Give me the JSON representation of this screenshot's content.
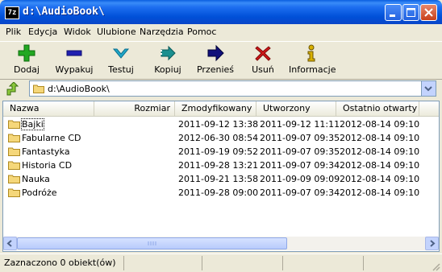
{
  "window": {
    "title": "d:\\AudioBook\\",
    "app_icon": "7z"
  },
  "menu": [
    "Plik",
    "Edycja",
    "Widok",
    "Ulubione",
    "Narzędzia",
    "Pomoc"
  ],
  "toolbar": [
    {
      "label": "Dodaj",
      "icon": "plus-icon",
      "color": "#22a822"
    },
    {
      "label": "Wypakuj",
      "icon": "minus-icon",
      "color": "#2020b0"
    },
    {
      "label": "Testuj",
      "icon": "check-icon",
      "color": "#1fa8c8"
    },
    {
      "label": "Kopiuj",
      "icon": "copy-arrow-icon",
      "color": "#1a8f8f"
    },
    {
      "label": "Przenieś",
      "icon": "move-arrow-icon",
      "color": "#10107a"
    },
    {
      "label": "Usuń",
      "icon": "delete-x-icon",
      "color": "#d01818"
    },
    {
      "label": "Informacje",
      "icon": "info-icon",
      "color": "#d8b000"
    }
  ],
  "address": {
    "path": "d:\\AudioBook\\"
  },
  "columns": [
    "Nazwa",
    "Rozmiar",
    "Zmodyfikowany",
    "Utworzony",
    "Ostatnio otwarty"
  ],
  "rows": [
    {
      "name": "Bajki",
      "size": "",
      "modified": "2011-09-12 13:38",
      "created": "2011-09-12 11:11",
      "accessed": "2012-08-14 09:10"
    },
    {
      "name": "Fabularne CD",
      "size": "",
      "modified": "2012-06-30 08:54",
      "created": "2011-09-07 09:35",
      "accessed": "2012-08-14 09:10"
    },
    {
      "name": "Fantastyka",
      "size": "",
      "modified": "2011-09-19 09:52",
      "created": "2011-09-07 09:35",
      "accessed": "2012-08-14 09:10"
    },
    {
      "name": "Historia CD",
      "size": "",
      "modified": "2011-09-28 13:21",
      "created": "2011-09-07 09:34",
      "accessed": "2012-08-14 09:10"
    },
    {
      "name": "Nauka",
      "size": "",
      "modified": "2011-09-21 13:58",
      "created": "2011-09-09 09:09",
      "accessed": "2012-08-14 09:10"
    },
    {
      "name": "Podróże",
      "size": "",
      "modified": "2011-09-28 09:00",
      "created": "2011-09-07 09:34",
      "accessed": "2012-08-14 09:10"
    }
  ],
  "status": {
    "text": "Zaznaczono 0 obiekt(ów)"
  }
}
